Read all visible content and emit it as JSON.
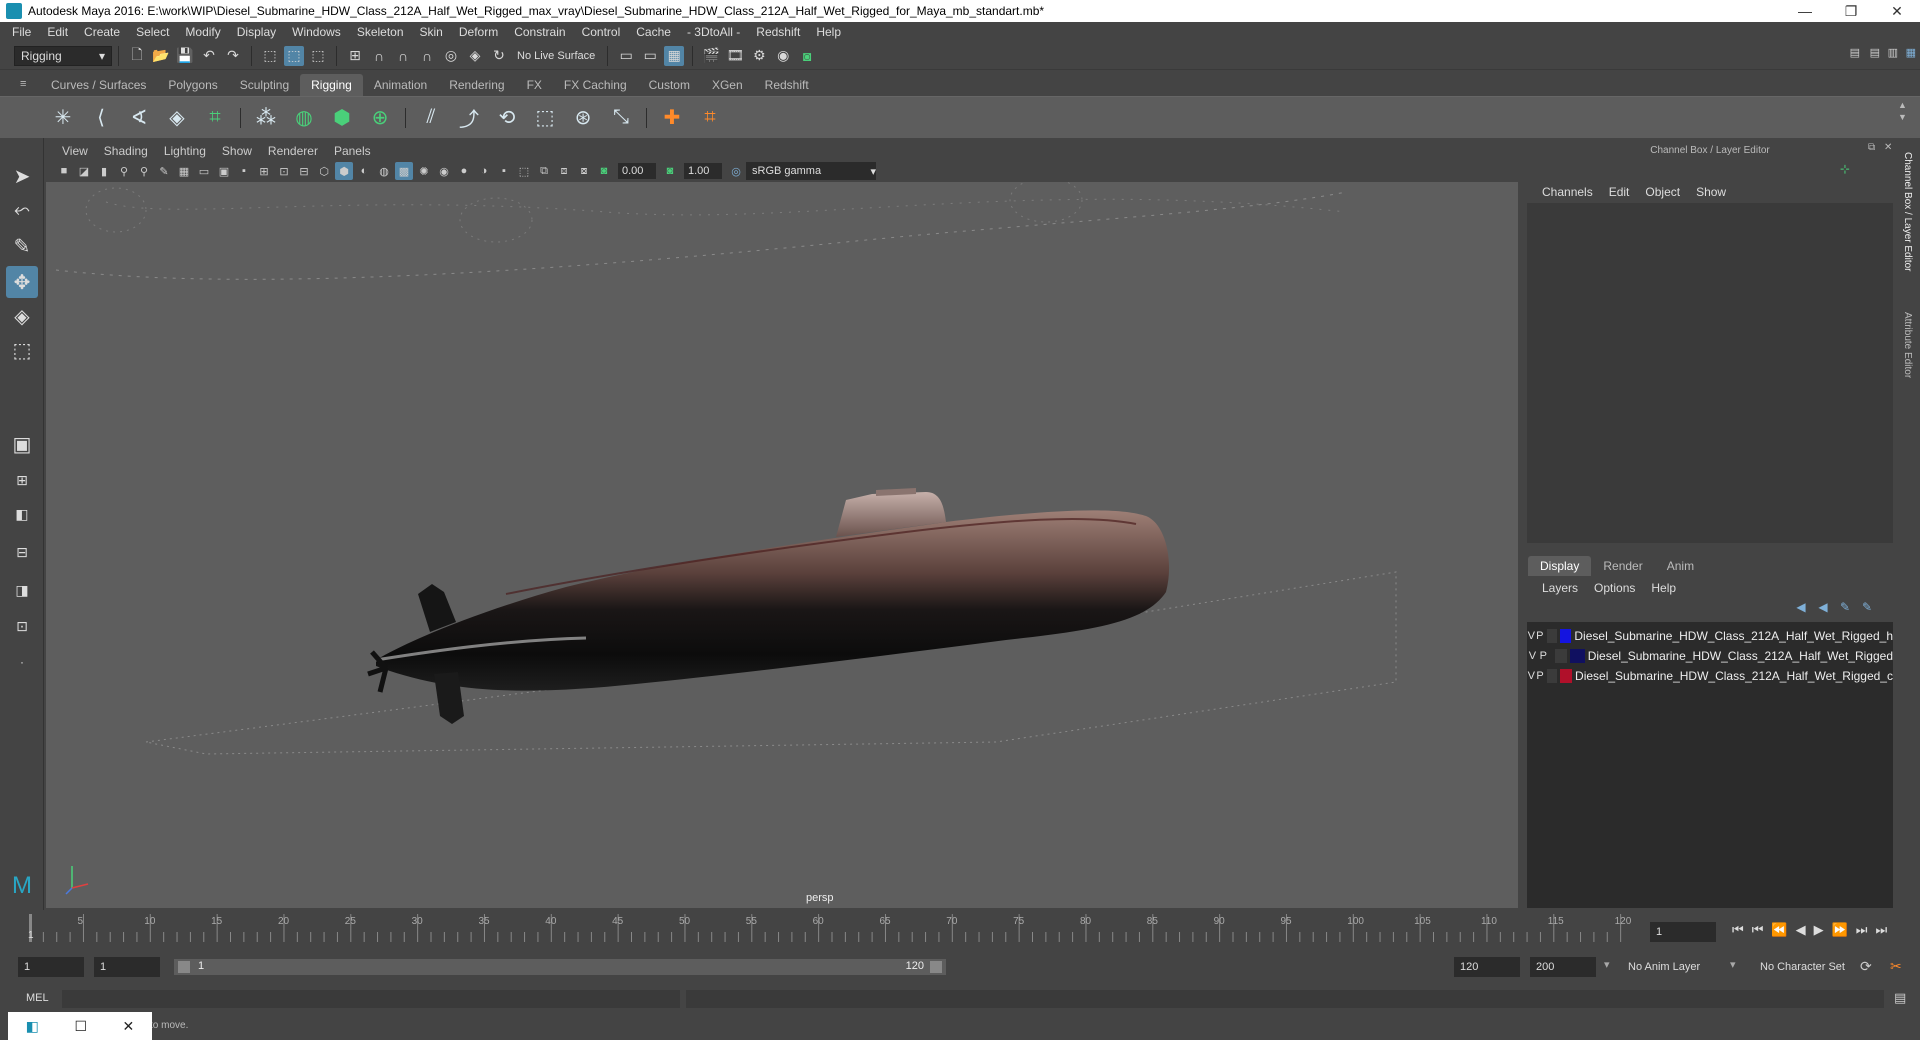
{
  "window": {
    "title": "Autodesk Maya 2016: E:\\work\\WIP\\Diesel_Submarine_HDW_Class_212A_Half_Wet_Rigged_max_vray\\Diesel_Submarine_HDW_Class_212A_Half_Wet_Rigged_for_Maya_mb_standart.mb*",
    "minimize": "—",
    "restore": "❐",
    "close": "✕"
  },
  "menubar": [
    "File",
    "Edit",
    "Create",
    "Select",
    "Modify",
    "Display",
    "Windows",
    "Skeleton",
    "Skin",
    "Deform",
    "Constrain",
    "Control",
    "Cache",
    "- 3DtoAll -",
    "Redshift",
    "Help"
  ],
  "statusline": {
    "mode": "Rigging",
    "live_surface": "No Live Surface"
  },
  "shelf_tabs": [
    "Curves / Surfaces",
    "Polygons",
    "Sculpting",
    "Rigging",
    "Animation",
    "Rendering",
    "FX",
    "FX Caching",
    "Custom",
    "XGen",
    "Redshift"
  ],
  "active_shelf_tab": "Rigging",
  "panel_menu": [
    "View",
    "Shading",
    "Lighting",
    "Show",
    "Renderer",
    "Panels"
  ],
  "view_toolbar": {
    "exposure": "0.00",
    "gamma": "1.00",
    "color_space": "sRGB gamma"
  },
  "viewport": {
    "camera_label": "persp"
  },
  "channel_box": {
    "title": "Channel Box / Layer Editor",
    "menu": [
      "Channels",
      "Edit",
      "Object",
      "Show"
    ]
  },
  "layer_editor": {
    "tabs": [
      "Display",
      "Render",
      "Anim"
    ],
    "active_tab": "Display",
    "menu": [
      "Layers",
      "Options",
      "Help"
    ],
    "layers": [
      {
        "v": "V",
        "p": "P",
        "name": "Diesel_Submarine_HDW_Class_212A_Half_Wet_Rigged_h",
        "color": "#1414e0"
      },
      {
        "v": "V",
        "p": "P",
        "name": "Diesel_Submarine_HDW_Class_212A_Half_Wet_Rigged",
        "color": "#101060"
      },
      {
        "v": "V",
        "p": "P",
        "name": "Diesel_Submarine_HDW_Class_212A_Half_Wet_Rigged_c",
        "color": "#b0102a"
      }
    ]
  },
  "side_tabs": [
    "Channel Box / Layer Editor",
    "Attribute Editor"
  ],
  "timeline": {
    "ticks": [
      "5",
      "10",
      "15",
      "20",
      "25",
      "30",
      "35",
      "40",
      "45",
      "50",
      "55",
      "60",
      "65",
      "70",
      "75",
      "80",
      "85",
      "90",
      "95",
      "100",
      "105",
      "110",
      "115",
      "120"
    ],
    "start_marker": "1",
    "current_frame": "1"
  },
  "range": {
    "start": "1",
    "anim_start": "1",
    "range_start": "1",
    "range_end": "120",
    "anim_end": "120",
    "end": "200",
    "anim_layer": "No Anim Layer",
    "character_set": "No Character Set"
  },
  "command_line": {
    "label": "MEL"
  },
  "help_line": {
    "text": "to move."
  }
}
